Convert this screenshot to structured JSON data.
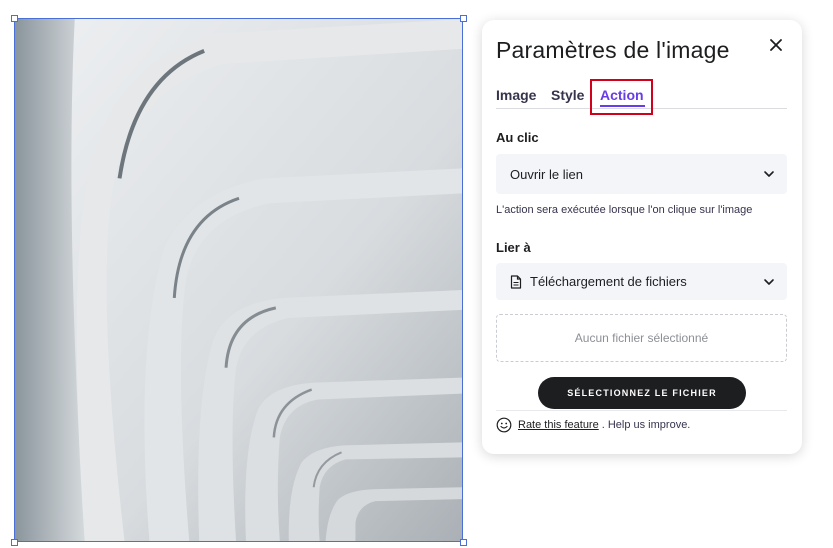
{
  "panel": {
    "title": "Paramètres de l'image",
    "close_icon": "close-icon",
    "tabs": [
      {
        "label": "Image",
        "active": false
      },
      {
        "label": "Style",
        "active": false
      },
      {
        "label": "Action",
        "active": true
      }
    ],
    "on_click": {
      "label": "Au clic",
      "selected": "Ouvrir le lien",
      "hint": "L'action sera exécutée lorsque l'on clique sur l'image"
    },
    "link_to": {
      "label": "Lier à",
      "selected": "Téléchargement de fichiers",
      "icon": "file-icon"
    },
    "file_drop": {
      "empty_text": "Aucun fichier sélectionné"
    },
    "select_file_button": "SÉLECTIONNEZ LE FICHIER",
    "feedback": {
      "link_text": "Rate this feature",
      "suffix": ". Help us improve.",
      "icon": "smiley-icon"
    }
  },
  "colors": {
    "accent": "#673de6",
    "highlight_border": "#d0021b",
    "selection_border": "#4a6fd6",
    "button_bg": "#1d1e20"
  }
}
